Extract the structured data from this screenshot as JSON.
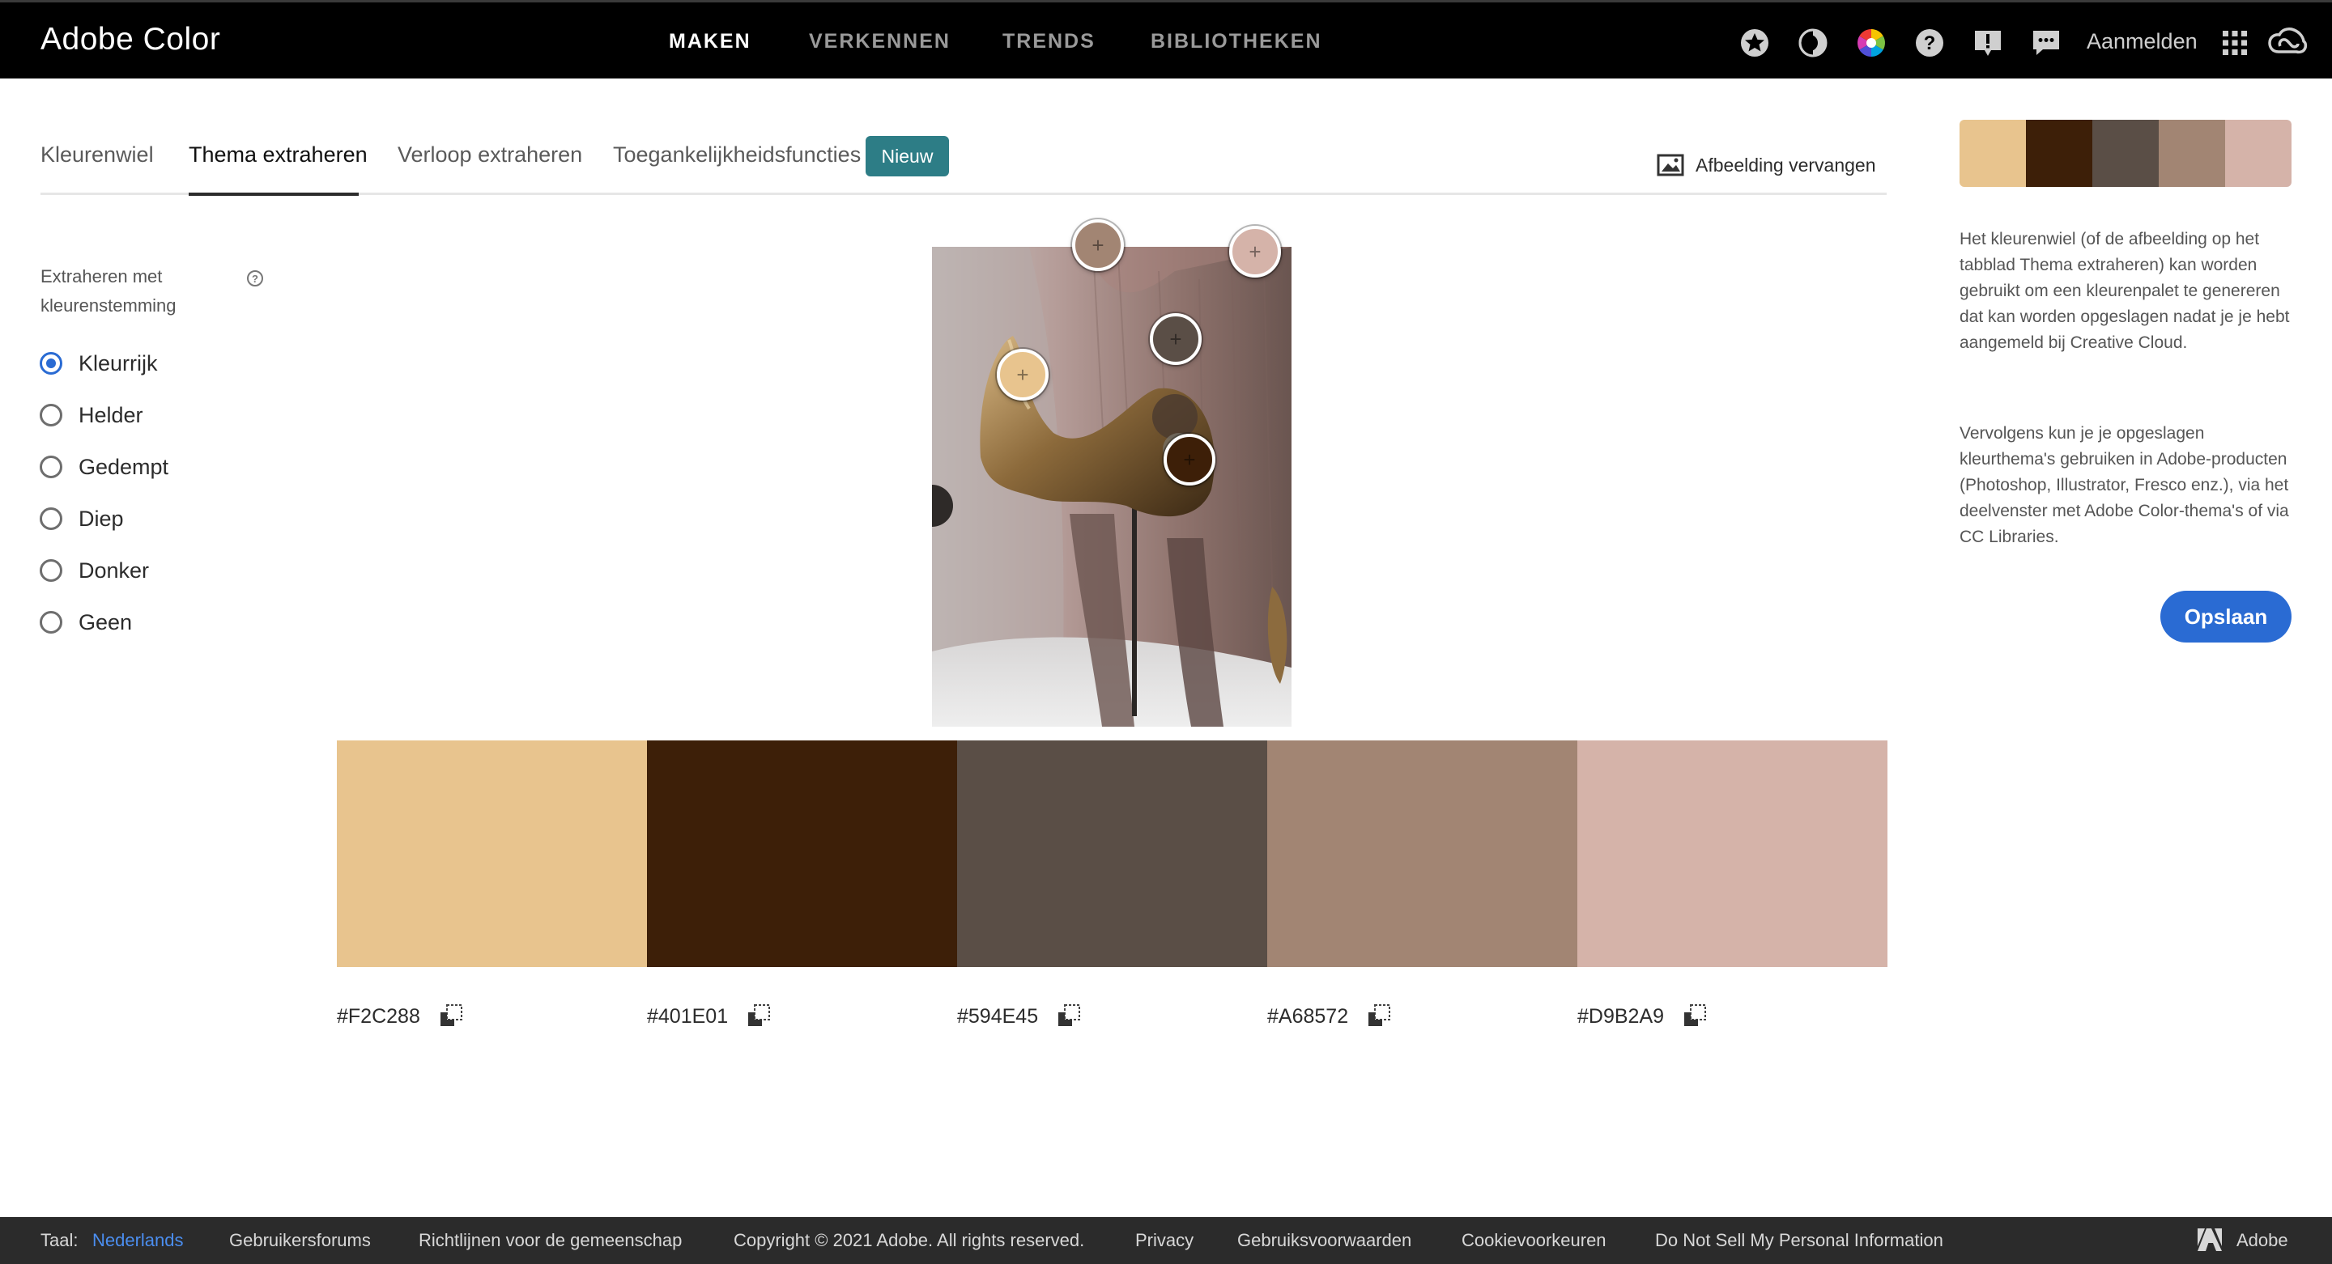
{
  "app": {
    "title": "Adobe Color"
  },
  "nav": {
    "items": [
      "MAKEN",
      "VERKENNEN",
      "TRENDS",
      "BIBLIOTHEKEN"
    ],
    "active": "MAKEN",
    "signin": "Aanmelden"
  },
  "top_icons": [
    "star-badge-icon",
    "contrast-icon",
    "color-wheel-icon",
    "help-icon",
    "feedback-icon",
    "chat-icon",
    "app-grid-icon",
    "creative-cloud-icon"
  ],
  "tabs": {
    "items": [
      "Kleurenwiel",
      "Thema extraheren",
      "Verloop extraheren",
      "Toegankelijkheidsfuncties"
    ],
    "active": "Thema extraheren",
    "new_badge": "Nieuw",
    "replace_image": "Afbeelding vervangen"
  },
  "mood": {
    "title": "Extraheren met kleurenstemming",
    "options": [
      "Kleurrijk",
      "Helder",
      "Gedempt",
      "Diep",
      "Donker",
      "Geen"
    ],
    "selected": "Kleurrijk"
  },
  "swatches": [
    {
      "hex": "#F2C288",
      "color": "#E8C48E"
    },
    {
      "hex": "#401E01",
      "color": "#3D1F08"
    },
    {
      "hex": "#594E45",
      "color": "#5A4E46"
    },
    {
      "hex": "#A68572",
      "color": "#A28573"
    },
    {
      "hex": "#D9B2A9",
      "color": "#D5B3A9"
    }
  ],
  "info": {
    "paragraph1": "Het kleurenwiel (of de afbeelding op het tabblad Thema extraheren) kan worden gebruikt om een kleurenpalet te genereren dat kan worden opgeslagen nadat je je hebt aangemeld bij Creative Cloud.",
    "paragraph2": "Vervolgens kun je je opgeslagen kleurthema's gebruiken in Adobe-producten (Photoshop, Illustrator, Fresco enz.), via het deelvenster met Adobe Color-thema's of via CC Libraries.",
    "save": "Opslaan"
  },
  "footer": {
    "language_label": "Taal:",
    "language": "Nederlands",
    "links": [
      "Gebruikersforums",
      "Richtlijnen voor de gemeenschap",
      "Copyright © 2021 Adobe. All rights reserved.",
      "Privacy",
      "Gebruiksvoorwaarden",
      "Cookievoorkeuren",
      "Do Not Sell My Personal Information"
    ],
    "brand": "Adobe"
  }
}
